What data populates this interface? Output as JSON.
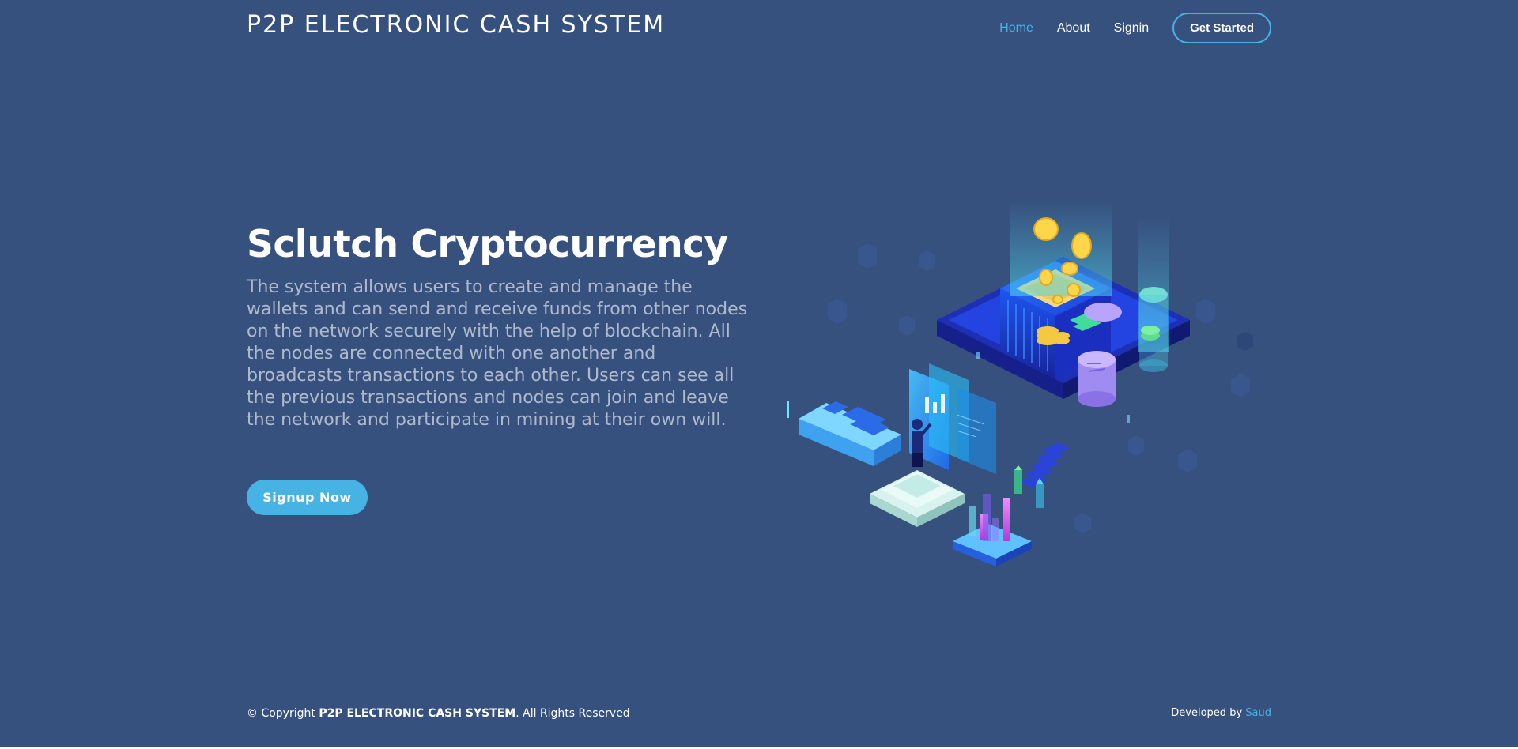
{
  "header": {
    "logo": "P2P ELECTRONIC CASH SYSTEM",
    "nav": {
      "home": "Home",
      "about": "About",
      "signin": "Signin",
      "get_started": "Get Started"
    }
  },
  "hero": {
    "title": "Sclutch Cryptocurrency",
    "description": "The system allows users to create and manage the wallets and can send and receive funds from other nodes on the network securely with the help of blockchain. All the nodes are connected with one another and broadcasts transactions to each other. Users can see all the previous transactions and nodes can join and leave the network and participate in mining at their own will.",
    "cta_label": "Signup Now",
    "illustration_icon": "isometric-blockchain-illustration"
  },
  "footer": {
    "copyright_prefix": "© Copyright ",
    "copyright_brand": "P2P ELECTRONIC CASH SYSTEM",
    "copyright_suffix": ". All Rights Reserved",
    "developed_by_label": "Developed by ",
    "developer_name": "Saud"
  },
  "colors": {
    "background": "#37517e",
    "accent": "#47b2e4",
    "text": "#ffffff"
  }
}
